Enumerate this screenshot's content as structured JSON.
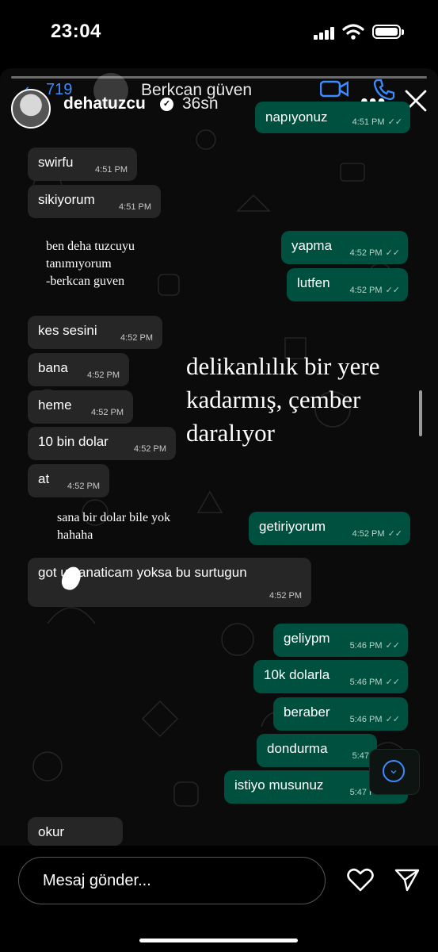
{
  "status_bar": {
    "time": "23:04",
    "battery_level": 1.0
  },
  "whatsapp_header": {
    "back_count": "719",
    "contact_name": "Berkcan güven"
  },
  "instagram": {
    "username": "dehatuzcu",
    "time_ago": "36sn",
    "story_progress": 0.0,
    "message_placeholder": "Mesaj gönder..."
  },
  "messages": [
    {
      "text": "napıyonuz",
      "time": "4:51 PM",
      "dir": "out"
    },
    {
      "text": "swirfu",
      "time": "4:51 PM",
      "dir": "in"
    },
    {
      "text": "sikiyorum",
      "time": "4:51 PM",
      "dir": "in"
    },
    {
      "text": "yapma",
      "time": "4:52 PM",
      "dir": "out"
    },
    {
      "text": "lutfen",
      "time": "4:52 PM",
      "dir": "out"
    },
    {
      "text": "kes sesini",
      "time": "4:52 PM",
      "dir": "in"
    },
    {
      "text": "bana",
      "time": "4:52 PM",
      "dir": "in"
    },
    {
      "text": "heme",
      "time": "4:52 PM",
      "dir": "in"
    },
    {
      "text": "10 bin dolar",
      "time": "4:52 PM",
      "dir": "in"
    },
    {
      "text": "at",
      "time": "4:52 PM",
      "dir": "in"
    },
    {
      "text": "getiriyorum",
      "time": "4:52 PM",
      "dir": "out"
    },
    {
      "text": "got u kanaticam yoksa bu surtugun",
      "time": "4:52 PM",
      "dir": "in"
    },
    {
      "text": "geliypm",
      "time": "5:46 PM",
      "dir": "out"
    },
    {
      "text": "10k dolarla",
      "time": "5:46 PM",
      "dir": "out"
    },
    {
      "text": "beraber",
      "time": "5:46 PM",
      "dir": "out"
    },
    {
      "text": "dondurma",
      "time": "5:47",
      "dir": "out"
    },
    {
      "text": "istiyo musunuz",
      "time": "5:47 PM",
      "dir": "out"
    },
    {
      "text": "okur",
      "time": "",
      "dir": "in"
    }
  ],
  "notes": {
    "note1": [
      "ben deha tuzcuyu",
      "tanımıyorum",
      "-berkcan guven"
    ],
    "note2": [
      "sana bir dolar bile yok",
      "hahaha"
    ]
  },
  "overlay_text": [
    "delikanlılık bir yere",
    "kadarmış, çember",
    "daralıyor"
  ],
  "colors": {
    "incoming": "#262626",
    "outgoing": "#00503f",
    "accent": "#3a8cff"
  },
  "icons": [
    "signal-icon",
    "wifi-icon",
    "battery-icon",
    "video-call-icon",
    "phone-icon",
    "more-icon",
    "close-icon",
    "scroll-down-icon",
    "heart-icon",
    "send-icon"
  ]
}
